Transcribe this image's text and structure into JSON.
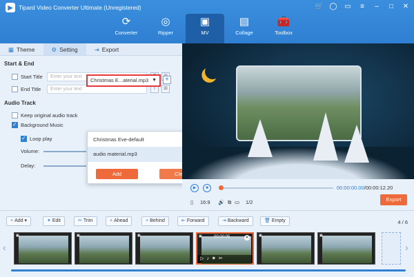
{
  "app": {
    "title": "Tipard Video Converter Ultimate (Unregistered)"
  },
  "nav": [
    {
      "label": "Converter",
      "icon": "converter-icon"
    },
    {
      "label": "Ripper",
      "icon": "ripper-icon"
    },
    {
      "label": "MV",
      "icon": "mv-icon",
      "active": true
    },
    {
      "label": "Collage",
      "icon": "collage-icon"
    },
    {
      "label": "Toolbox",
      "icon": "toolbox-icon"
    }
  ],
  "tabs": [
    {
      "label": "Theme",
      "icon": "theme-icon"
    },
    {
      "label": "Setting",
      "icon": "gear-icon",
      "active": true
    },
    {
      "label": "Export",
      "icon": "export-icon"
    }
  ],
  "start_end": {
    "title": "Start & End",
    "start_label": "Start Title",
    "end_label": "End Title",
    "placeholder": "Enter your text"
  },
  "audio": {
    "title": "Audio Track",
    "keep_label": "Keep original audio track",
    "bg_label": "Background Music",
    "selected": "Christmas E...aterial.mp3",
    "loop_label": "Loop play",
    "volume_label": "Volume:",
    "delay_label": "Delay:"
  },
  "dropdown": {
    "items": [
      "Christmas Eve-default",
      "audio material.mp3"
    ],
    "add_label": "Add",
    "clear_label": "Clear"
  },
  "player": {
    "current": "00:00:00.00",
    "total": "00:00:12.20",
    "ratio": "16:9",
    "page": "1/2",
    "export_label": "Export"
  },
  "toolbar": {
    "add": "Add",
    "edit": "Edit",
    "trim": "Trim",
    "ahead": "Ahead",
    "behind": "Behind",
    "forward": "Forward",
    "backward": "Backward",
    "empty": "Empty",
    "counter": "4 / 6"
  },
  "timeline": {
    "active_duration": "00:00:05",
    "thumb_tag": "Video"
  },
  "colors": {
    "accent": "#2f7fd2",
    "orange": "#ee6a3b",
    "highlight": "#e8373a"
  }
}
